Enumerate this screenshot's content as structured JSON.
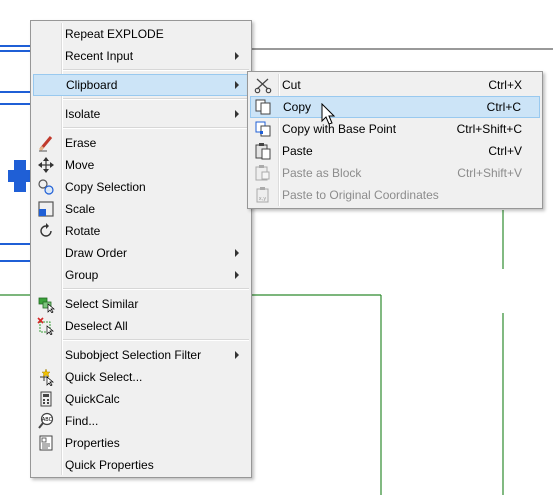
{
  "main_menu": {
    "items": [
      {
        "label": "Repeat EXPLODE"
      },
      {
        "label": "Recent Input"
      },
      {
        "label": "Clipboard"
      },
      {
        "label": "Isolate"
      },
      {
        "label": "Erase",
        "icon": "eraser-icon"
      },
      {
        "label": "Move",
        "icon": "move-icon"
      },
      {
        "label": "Copy Selection",
        "icon": "copy-selection-icon"
      },
      {
        "label": "Scale",
        "icon": "scale-icon"
      },
      {
        "label": "Rotate",
        "icon": "rotate-icon"
      },
      {
        "label": "Draw Order"
      },
      {
        "label": "Group"
      },
      {
        "label": "Select Similar",
        "icon": "select-similar-icon"
      },
      {
        "label": "Deselect All",
        "icon": "deselect-all-icon"
      },
      {
        "label": "Subobject Selection Filter"
      },
      {
        "label": "Quick Select...",
        "icon": "quick-select-icon"
      },
      {
        "label": "QuickCalc",
        "icon": "calculator-icon"
      },
      {
        "label": "Find...",
        "icon": "find-text-icon"
      },
      {
        "label": "Properties",
        "icon": "properties-icon"
      },
      {
        "label": "Quick Properties"
      }
    ]
  },
  "clipboard_submenu": {
    "items": [
      {
        "label": "Cut",
        "shortcut": "Ctrl+X",
        "icon": "scissors-icon"
      },
      {
        "label": "Copy",
        "shortcut": "Ctrl+C",
        "icon": "copy-icon"
      },
      {
        "label": "Copy with Base Point",
        "shortcut": "Ctrl+Shift+C",
        "icon": "copy-base-point-icon"
      },
      {
        "label": "Paste",
        "shortcut": "Ctrl+V",
        "icon": "paste-icon"
      },
      {
        "label": "Paste as Block",
        "shortcut": "Ctrl+Shift+V",
        "icon": "paste-block-icon"
      },
      {
        "label": "Paste to Original Coordinates",
        "shortcut": "",
        "icon": "paste-original-coordinates-icon"
      }
    ]
  },
  "colors": {
    "highlight": "#cce4f7",
    "highlight_border": "#99c9ef",
    "drawing_blue": "#1f5fd6",
    "drawing_green": "#2e8b2e",
    "disabled_text": "#8c8c8c"
  }
}
